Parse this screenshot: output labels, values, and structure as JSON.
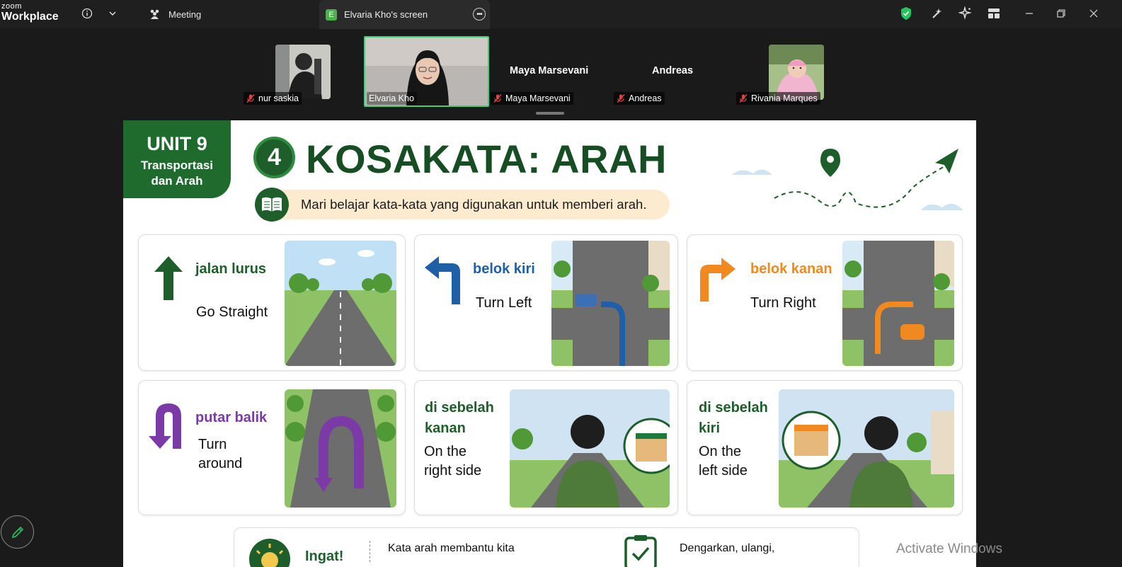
{
  "app": {
    "logo_line1": "zoom",
    "logo_line2": "Workplace",
    "tab_meeting_label": "Meeting",
    "tab_screen_label": "Elvaria Kho's screen",
    "tab_screen_badge": "E"
  },
  "participants": [
    {
      "name": "nur saskia",
      "muted": true,
      "has_video": true
    },
    {
      "name": "Elvaria Kho",
      "muted": false,
      "has_video": true,
      "active_speaker": true
    },
    {
      "name": "Maya Marsevani",
      "display_name": "Maya Marsevani",
      "muted": true,
      "has_video": false
    },
    {
      "name": "Andreas",
      "display_name": "Andreas",
      "muted": true,
      "has_video": false
    },
    {
      "name": "Rivania Marques",
      "muted": true,
      "has_video": true
    }
  ],
  "slide": {
    "unit_label": "UNIT 9",
    "unit_topic_line1": "Transportasi",
    "unit_topic_line2": "dan Arah",
    "section_number": "4",
    "title": "KOSAKATA: ARAH",
    "subtitle": "Mari belajar kata-kata yang digunakan untuk memberi arah.",
    "cards": [
      {
        "term": "jalan lurus",
        "meaning": "Go Straight",
        "color": "#1e5e2a"
      },
      {
        "term": "belok kiri",
        "meaning": "Turn Left",
        "color": "#1f5fa8"
      },
      {
        "term": "belok kanan",
        "meaning": "Turn Right",
        "color": "#f0891f"
      },
      {
        "term": "putar balik",
        "meaning_line1": "Turn",
        "meaning_line2": "around",
        "color": "#7b3aa6"
      },
      {
        "term_line1": "di sebelah",
        "term_line2": "kanan",
        "meaning_line1": "On the",
        "meaning_line2": "right side",
        "color": "#1e5e2a"
      },
      {
        "term_line1": "di sebelah",
        "term_line2": "kiri",
        "meaning_line1": "On the",
        "meaning_line2": "left side",
        "color": "#1e5e2a"
      }
    ],
    "reminder_label": "Ingat!",
    "reminder_text": "Kata arah membantu kita",
    "tip_text": "Dengarkan, ulangi,"
  },
  "overlay": {
    "watermark": "Activate Windows"
  },
  "colors": {
    "brand_green": "#1f6b2e",
    "title_green": "#164d23",
    "active_speaker_border": "#3fd17a",
    "shield_green": "#22c55e"
  }
}
